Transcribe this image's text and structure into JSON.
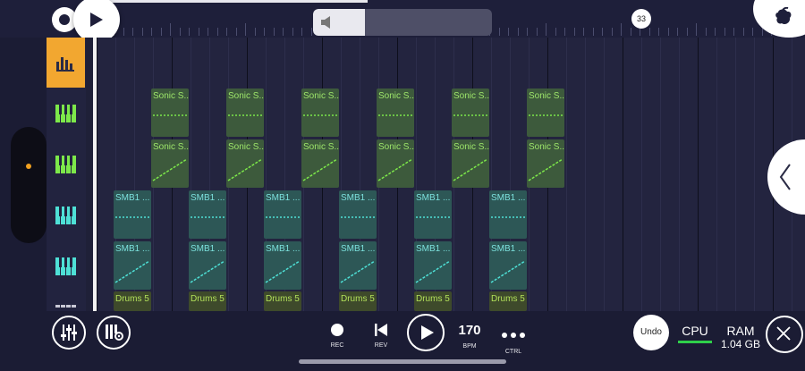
{
  "app": {
    "tempo_marker": "33",
    "accent_color": "#f2a730",
    "icons": [
      "fl-logo-c-icon",
      "play-icon",
      "volume-icon",
      "fl-fruit-logo-icon",
      "playlist-bars-icon",
      "piano-keys-icon"
    ]
  },
  "tracks": [
    {
      "icon": "playlist-bars-icon",
      "active": true
    },
    {
      "icon": "piano-keys-icon",
      "color": "#7de84a"
    },
    {
      "icon": "piano-keys-icon",
      "color": "#7de84a"
    },
    {
      "icon": "piano-keys-icon",
      "color": "#4ee0d6"
    },
    {
      "icon": "piano-keys-icon",
      "color": "#4ee0d6"
    }
  ],
  "clips": {
    "sonic_label": "Sonic S...",
    "smb_label": "SMB1 ...",
    "drums_label": "Drums 5"
  },
  "transport": {
    "rec_label": "REC",
    "rev_label": "REV",
    "bpm_value": "170",
    "bpm_label": "BPM",
    "ctrl_label": "CTRL"
  },
  "status": {
    "undo_label": "Undo",
    "cpu_label": "CPU",
    "ram_label": "RAM",
    "ram_value": "1.04 GB"
  }
}
